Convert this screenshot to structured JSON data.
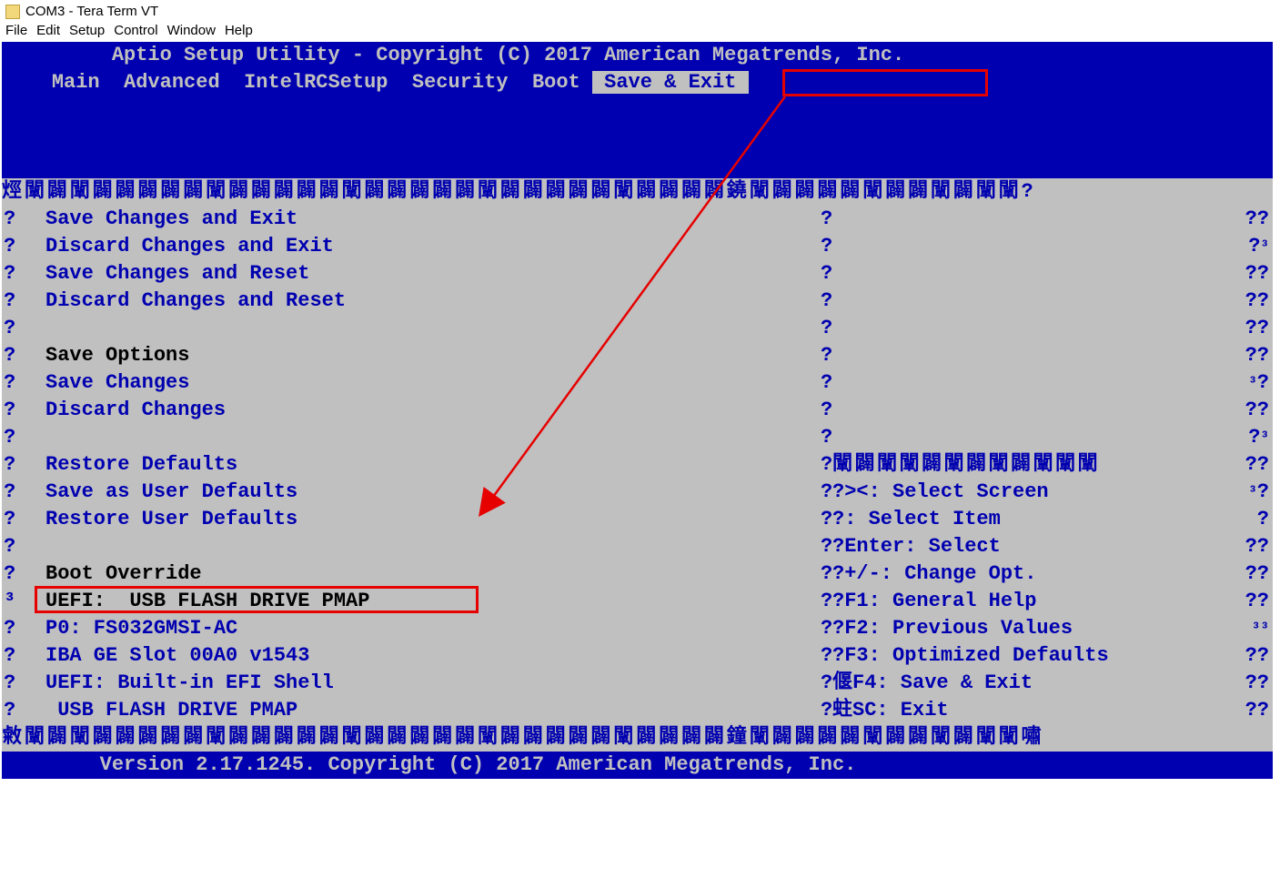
{
  "window": {
    "title": "COM3 - Tera Term VT"
  },
  "menubar": [
    "File",
    "Edit",
    "Setup",
    "Control",
    "Window",
    "Help"
  ],
  "header": "Aptio Setup Utility - Copyright (C) 2017 American Megatrends, Inc.",
  "tabs": {
    "items": [
      "Main",
      "Advanced",
      "IntelRCSetup",
      "Security",
      "Boot"
    ],
    "selected": " Save & Exit "
  },
  "cjk_top": "烴闡闢闡闢闢闢闢闢闡闢闢闢闢闢闡闢闢闢闢闢闡闢闢闢闢闢闡闢闢闢闢鐃闡闢闢闢闢闡闢闢闡闢闡闡?",
  "left": {
    "items": [
      {
        "text": "Save Changes and Exit",
        "style": "blue"
      },
      {
        "text": "Discard Changes and Exit",
        "style": "blue"
      },
      {
        "text": "Save Changes and Reset",
        "style": "blue"
      },
      {
        "text": "Discard Changes and Reset",
        "style": "blue"
      },
      {
        "text": "",
        "style": "blank"
      },
      {
        "text": "Save Options",
        "style": "black"
      },
      {
        "text": "Save Changes",
        "style": "blue"
      },
      {
        "text": "Discard Changes",
        "style": "blue"
      },
      {
        "text": "",
        "style": "blank"
      },
      {
        "text": "Restore Defaults",
        "style": "blue"
      },
      {
        "text": "Save as User Defaults",
        "style": "blue"
      },
      {
        "text": "Restore User Defaults",
        "style": "blue"
      },
      {
        "text": "",
        "style": "blank"
      },
      {
        "text": "Boot Override",
        "style": "black"
      },
      {
        "text": "UEFI:  USB FLASH DRIVE PMAP",
        "style": "black",
        "hl": true
      },
      {
        "text": "P0: FS032GMSI-AC",
        "style": "blue"
      },
      {
        "text": "IBA GE Slot 00A0 v1543",
        "style": "blue"
      },
      {
        "text": "UEFI: Built-in EFI Shell",
        "style": "blue"
      },
      {
        "text": " USB FLASH DRIVE PMAP",
        "style": "blue"
      }
    ]
  },
  "right_help": {
    "sep_row": "闡闢闡闡闢闡闢闡闢闡闡闡",
    "lines": [
      "><: Select Screen",
      ": Select Item",
      "Enter: Select",
      "+/-: Change Opt.",
      "F1: General Help",
      "F2: Previous Values",
      "F3: Optimized Defaults",
      "F4: Save & Exit",
      "SC: Exit"
    ],
    "prefix_special": [
      "?",
      "?",
      "?",
      "?",
      "?",
      "?",
      "?",
      "偃",
      "蛀"
    ]
  },
  "right_marks": {
    "row_marks": [
      "??",
      "?³",
      "??",
      "??",
      "??",
      "??",
      "³?",
      "??",
      "?³",
      "??",
      "³?",
      " ?",
      "??",
      "??",
      "??",
      "³³",
      "??",
      "??",
      "??"
    ]
  },
  "cjk_bottom": "敹闡闢闡闢闢闢闢闢闡闢闢闢闢闢闡闢闢闢闢闢闡闢闢闢闢闢闡闢闢闢闢鐘闡闢闢闢闢闡闢闢闡闢闡闡嘯",
  "footer": "Version 2.17.1245. Copyright (C) 2017 American Megatrends, Inc."
}
